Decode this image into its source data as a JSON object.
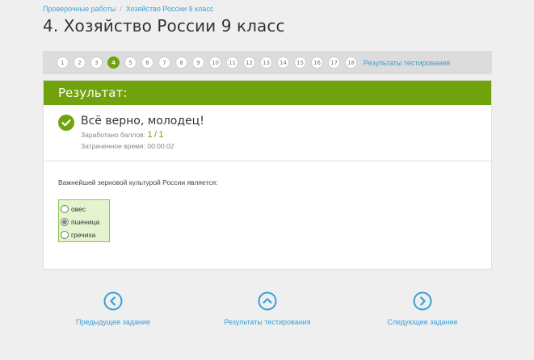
{
  "breadcrumb": {
    "items": [
      "Проверочные работы",
      "Хозяйство России 9 класс"
    ],
    "separator": "/"
  },
  "page_title": "4. Хозяйство России 9 класс",
  "pager": {
    "pages": [
      "1",
      "2",
      "3",
      "4",
      "5",
      "6",
      "7",
      "8",
      "9",
      "10",
      "11",
      "12",
      "13",
      "14",
      "15",
      "16",
      "17",
      "18"
    ],
    "active": "4",
    "results_label": "Результаты тестирования"
  },
  "result": {
    "header": "Результат:",
    "title": "Всё верно, молодец!",
    "score_label": "Заработано баллов:",
    "score_earned": "1",
    "score_sep": "/",
    "score_total": "1",
    "time_label": "Затраченное время:",
    "time_value": "00:00:02"
  },
  "question": {
    "text": "Важнейшей зерновой культурой России является:",
    "options": [
      {
        "label": "овес",
        "checked": false
      },
      {
        "label": "пшеница",
        "checked": true
      },
      {
        "label": "гречиха",
        "checked": false
      }
    ]
  },
  "nav": {
    "prev_label": "Предыдущее задание",
    "results_label": "Результаты тестирования",
    "next_label": "Следующее задание"
  },
  "colors": {
    "accent_green": "#70a30b",
    "link_blue": "#3aa0d8"
  },
  "icons": {
    "check": "check-circle-icon",
    "prev": "chevron-left-circle-icon",
    "results": "chevron-up-circle-icon",
    "next": "chevron-right-circle-icon"
  }
}
